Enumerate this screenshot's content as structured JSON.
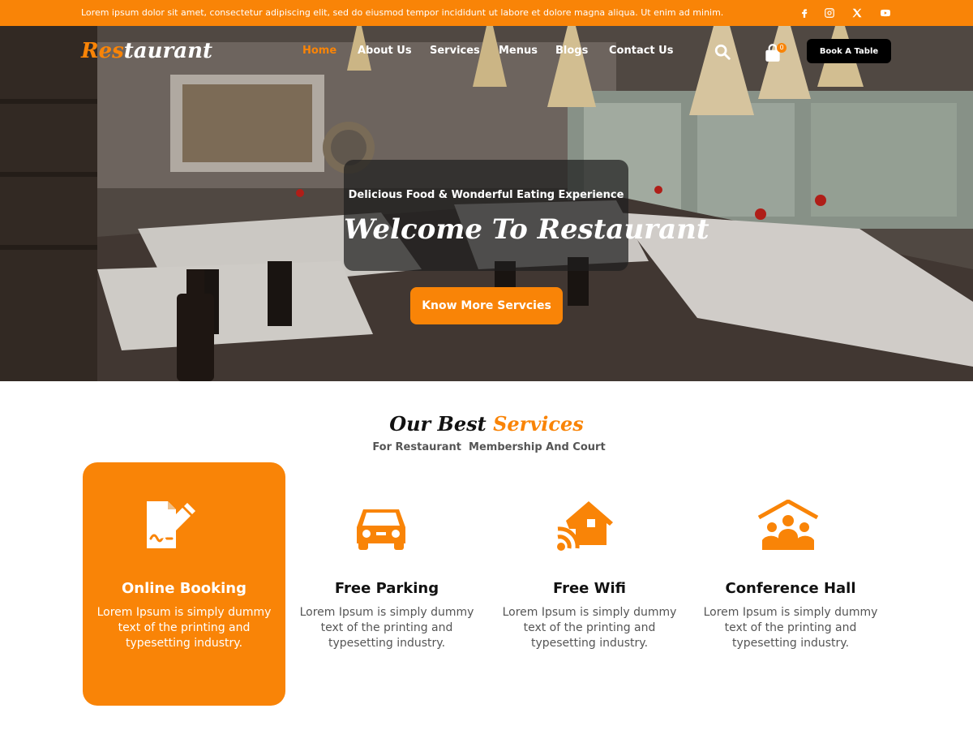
{
  "topbar": {
    "announcement": "Lorem ipsum dolor sit amet, consectetur adipiscing elit, sed do eiusmod tempor incididunt ut labore et dolore magna aliqua. Ut enim ad minim.",
    "social": [
      {
        "icon": "facebook-icon"
      },
      {
        "icon": "instagram-icon"
      },
      {
        "icon": "x-icon"
      },
      {
        "icon": "youtube-icon"
      }
    ],
    "color": "#f98407"
  },
  "header": {
    "logo_accent": "Res",
    "logo_rest": "taurant",
    "nav": [
      {
        "label": "Home",
        "active": true
      },
      {
        "label": "About Us"
      },
      {
        "label": "Services"
      },
      {
        "label": "Menus"
      },
      {
        "label": "Blogs"
      },
      {
        "label": "Contact Us"
      }
    ],
    "cart_count": "0",
    "book_label": "Book A Table"
  },
  "hero": {
    "subtitle": "Delicious Food & Wonderful Eating Experience",
    "title": "Welcome To  Restaurant",
    "cta": "Know More Servcies"
  },
  "services": {
    "title_main": "Our Best ",
    "title_accent": "Services",
    "subtitle": "For Restaurant  Membership And Court",
    "cards": [
      {
        "icon": "online-booking-icon",
        "title": "Online Booking",
        "text": "Lorem Ipsum is simply dummy text of the printing and typesetting industry."
      },
      {
        "icon": "car-icon",
        "title": "Free Parking",
        "text": "Lorem Ipsum is simply dummy text of the printing and typesetting industry."
      },
      {
        "icon": "wifi-home-icon",
        "title": "Free Wifi",
        "text": "Lorem Ipsum is simply dummy text of the printing and typesetting industry."
      },
      {
        "icon": "conference-hall-icon",
        "title": "Conference Hall",
        "text": "Lorem Ipsum is simply dummy text of the printing and typesetting industry."
      }
    ]
  },
  "colors": {
    "accent": "#f98407",
    "dark": "#000000"
  }
}
